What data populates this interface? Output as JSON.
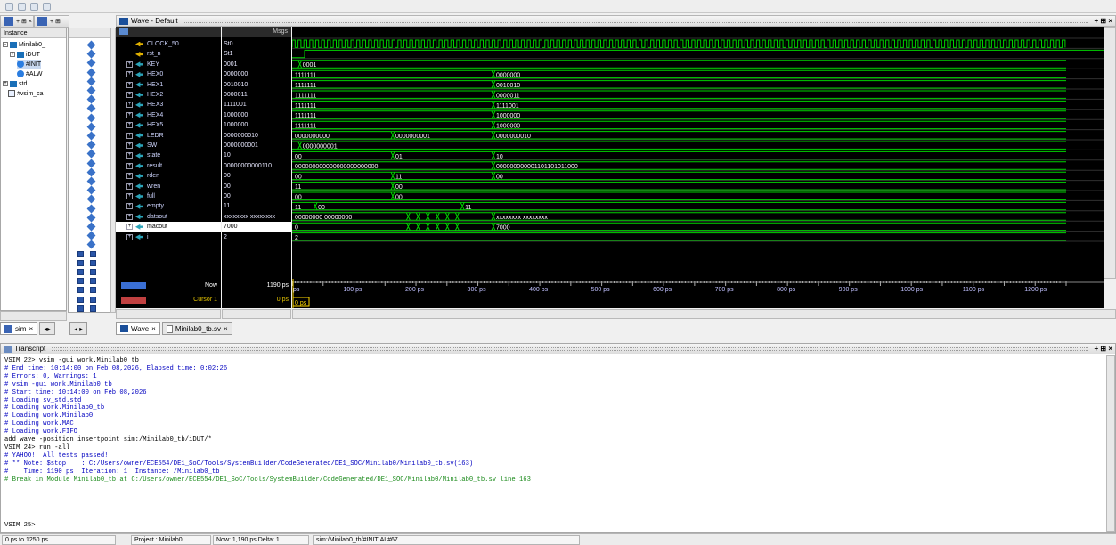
{
  "wave_panel": {
    "title": "Wave - Default",
    "msgs_label": "Msgs"
  },
  "instance_panel": {
    "header": "Instance",
    "items": [
      "Minilab0_",
      "iDUT",
      "#INIT",
      "#ALW",
      "std",
      "#vsim_ca"
    ]
  },
  "signals": [
    {
      "name": "CLOCK_50",
      "value": "St0",
      "expand": false,
      "icon": "signal-icon"
    },
    {
      "name": "rst_n",
      "value": "St1",
      "expand": false,
      "icon": "signal-icon"
    },
    {
      "name": "KEY",
      "value": "0001",
      "expand": true,
      "icon": "bus-icon"
    },
    {
      "name": "HEX0",
      "value": "0000000",
      "expand": true,
      "icon": "bus-icon"
    },
    {
      "name": "HEX1",
      "value": "0010010",
      "expand": true,
      "icon": "bus-icon"
    },
    {
      "name": "HEX2",
      "value": "0000011",
      "expand": true,
      "icon": "bus-icon"
    },
    {
      "name": "HEX3",
      "value": "1111001",
      "expand": true,
      "icon": "bus-icon"
    },
    {
      "name": "HEX4",
      "value": "1000000",
      "expand": true,
      "icon": "bus-icon"
    },
    {
      "name": "HEX5",
      "value": "1000000",
      "expand": true,
      "icon": "bus-icon"
    },
    {
      "name": "LEDR",
      "value": "0000000010",
      "expand": true,
      "icon": "bus-icon"
    },
    {
      "name": "SW",
      "value": "0000000001",
      "expand": true,
      "icon": "bus-icon"
    },
    {
      "name": "state",
      "value": "10",
      "expand": true,
      "icon": "bus-icon"
    },
    {
      "name": "result",
      "value": "00000000000110...",
      "expand": true,
      "icon": "bus-icon"
    },
    {
      "name": "rden",
      "value": "00",
      "expand": true,
      "icon": "bus-icon"
    },
    {
      "name": "wren",
      "value": "00",
      "expand": true,
      "icon": "bus-icon"
    },
    {
      "name": "full",
      "value": "00",
      "expand": true,
      "icon": "bus-icon"
    },
    {
      "name": "empty",
      "value": "11",
      "expand": true,
      "icon": "bus-icon"
    },
    {
      "name": "datsout",
      "value": "xxxxxxxx xxxxxxxx",
      "expand": true,
      "icon": "bus-icon"
    },
    {
      "name": "macout",
      "value": "7000",
      "expand": true,
      "icon": "bus-icon"
    },
    {
      "name": "i",
      "value": "2",
      "expand": true,
      "icon": "bus-icon"
    }
  ],
  "wave_labels": [
    {
      "row": 2,
      "t": 0.01,
      "text": "0001"
    },
    {
      "row": 3,
      "t": 0.0,
      "text": "1111111"
    },
    {
      "row": 3,
      "t": 0.26,
      "text": "0000000"
    },
    {
      "row": 4,
      "t": 0.0,
      "text": "1111111"
    },
    {
      "row": 4,
      "t": 0.26,
      "text": "0010010"
    },
    {
      "row": 5,
      "t": 0.0,
      "text": "1111111"
    },
    {
      "row": 5,
      "t": 0.26,
      "text": "0000011"
    },
    {
      "row": 6,
      "t": 0.0,
      "text": "1111111"
    },
    {
      "row": 6,
      "t": 0.26,
      "text": "1111001"
    },
    {
      "row": 7,
      "t": 0.0,
      "text": "1111111"
    },
    {
      "row": 7,
      "t": 0.26,
      "text": "1000000"
    },
    {
      "row": 8,
      "t": 0.0,
      "text": "1111111"
    },
    {
      "row": 8,
      "t": 0.26,
      "text": "1000000"
    },
    {
      "row": 9,
      "t": 0.0,
      "text": "0000000000"
    },
    {
      "row": 9,
      "t": 0.13,
      "text": "0000000001"
    },
    {
      "row": 9,
      "t": 0.26,
      "text": "0000000010"
    },
    {
      "row": 10,
      "t": 0.01,
      "text": "0000000001"
    },
    {
      "row": 11,
      "t": 0.0,
      "text": "00"
    },
    {
      "row": 11,
      "t": 0.13,
      "text": "01"
    },
    {
      "row": 11,
      "t": 0.26,
      "text": "10"
    },
    {
      "row": 12,
      "t": 0.0,
      "text": "000000000000000000000000"
    },
    {
      "row": 12,
      "t": 0.26,
      "text": "000000000001101101011000"
    },
    {
      "row": 13,
      "t": 0.0,
      "text": "00"
    },
    {
      "row": 13,
      "t": 0.13,
      "text": "11"
    },
    {
      "row": 13,
      "t": 0.26,
      "text": "00"
    },
    {
      "row": 14,
      "t": 0.0,
      "text": "11"
    },
    {
      "row": 14,
      "t": 0.13,
      "text": "00"
    },
    {
      "row": 15,
      "t": 0.0,
      "text": "00"
    },
    {
      "row": 15,
      "t": 0.13,
      "text": "00"
    },
    {
      "row": 16,
      "t": 0.0,
      "text": "11"
    },
    {
      "row": 16,
      "t": 0.03,
      "text": "00"
    },
    {
      "row": 16,
      "t": 0.22,
      "text": "11"
    },
    {
      "row": 17,
      "t": 0.0,
      "text": "00000000 00000000"
    },
    {
      "row": 17,
      "t": 0.26,
      "text": "xxxxxxxx xxxxxxxx"
    },
    {
      "row": 18,
      "t": 0.0,
      "text": "0"
    },
    {
      "row": 18,
      "t": 0.26,
      "text": "7000"
    },
    {
      "row": 19,
      "t": 0.0,
      "text": "2"
    }
  ],
  "cursor": {
    "now_label": "Now",
    "now_value": "1190 ps",
    "cursor_label": "Cursor 1",
    "cursor_value": "0 ps",
    "cursor_flag": "0 ps"
  },
  "timeline": [
    "ps",
    "100 ps",
    "200 ps",
    "300 ps",
    "400 ps",
    "500 ps",
    "600 ps",
    "700 ps",
    "800 ps",
    "900 ps",
    "1000 ps",
    "1100 ps",
    "1200 ps"
  ],
  "tabs": {
    "sim": "sim",
    "wave": "Wave",
    "file": "Minilab0_tb.sv"
  },
  "transcript": {
    "title": "Transcript",
    "lines": [
      {
        "text": "VSIM 22> vsim -gui work.Minilab0_tb",
        "color": "#000000"
      },
      {
        "text": "# End time: 10:14:00 on Feb 08,2026, Elapsed time: 0:02:26",
        "color": "#0000c0"
      },
      {
        "text": "# Errors: 0, Warnings: 1",
        "color": "#0000c0"
      },
      {
        "text": "# vsim -gui work.Minilab0_tb",
        "color": "#0000c0"
      },
      {
        "text": "# Start time: 10:14:00 on Feb 08,2026",
        "color": "#0000c0"
      },
      {
        "text": "# Loading sv_std.std",
        "color": "#0000c0"
      },
      {
        "text": "# Loading work.Minilab0_tb",
        "color": "#0000c0"
      },
      {
        "text": "# Loading work.Minilab0",
        "color": "#0000c0"
      },
      {
        "text": "# Loading work.MAC",
        "color": "#0000c0"
      },
      {
        "text": "# Loading work.FIFO",
        "color": "#0000c0"
      },
      {
        "text": "add wave -position insertpoint sim:/Minilab0_tb/iDUT/*",
        "color": "#000000"
      },
      {
        "text": "VSIM 24> run -all",
        "color": "#000000"
      },
      {
        "text": "# YAHOO!! All tests passed!",
        "color": "#0000c0"
      },
      {
        "text": "# ** Note: $stop    : C:/Users/owner/ECE554/DE1_SoC/Tools/SystemBuilder/CodeGenerated/DE1_SOC/Minilab0/Minilab0_tb.sv(163)",
        "color": "#0000c0"
      },
      {
        "text": "#    Time: 1190 ps  Iteration: 1  Instance: /Minilab0_tb",
        "color": "#0000c0"
      },
      {
        "text": "# Break in Module Minilab0_tb at C:/Users/owner/ECE554/DE1_SoC/Tools/SystemBuilder/CodeGenerated/DE1_SOC/Minilab0/Minilab0_tb.sv line 163",
        "color": "#1a8a1a"
      }
    ],
    "prompt": "VSIM 25>"
  },
  "status": {
    "range": "0 ps to 1250 ps",
    "project": "Project : Minilab0",
    "now": "Now: 1,190 ps  Delta: 1",
    "scope": "sim:/Minilab0_tb/#INITIAL#67"
  },
  "colors": {
    "wave_green": "#00d200",
    "bg_black": "#000000",
    "cursor_yellow": "#ffd800",
    "text_blue": "#0000c0",
    "text_green": "#1a8a1a"
  }
}
